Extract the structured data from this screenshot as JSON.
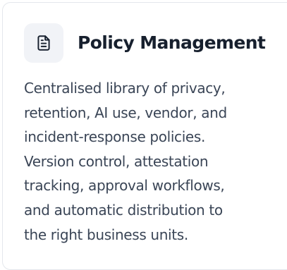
{
  "card": {
    "icon": "document-icon",
    "title": "Policy Management",
    "description_lines": [
      "Centralised library of privacy,",
      "retention, AI use, vendor, and",
      "incident-response policies.",
      "Version control, attestation",
      "tracking, approval workflows,",
      "and automatic distribution to",
      "the right business units."
    ]
  },
  "colors": {
    "icon_bg": "#f1f3f7",
    "title": "#17202e",
    "text": "#3a4556",
    "border": "#e4e7ec"
  }
}
